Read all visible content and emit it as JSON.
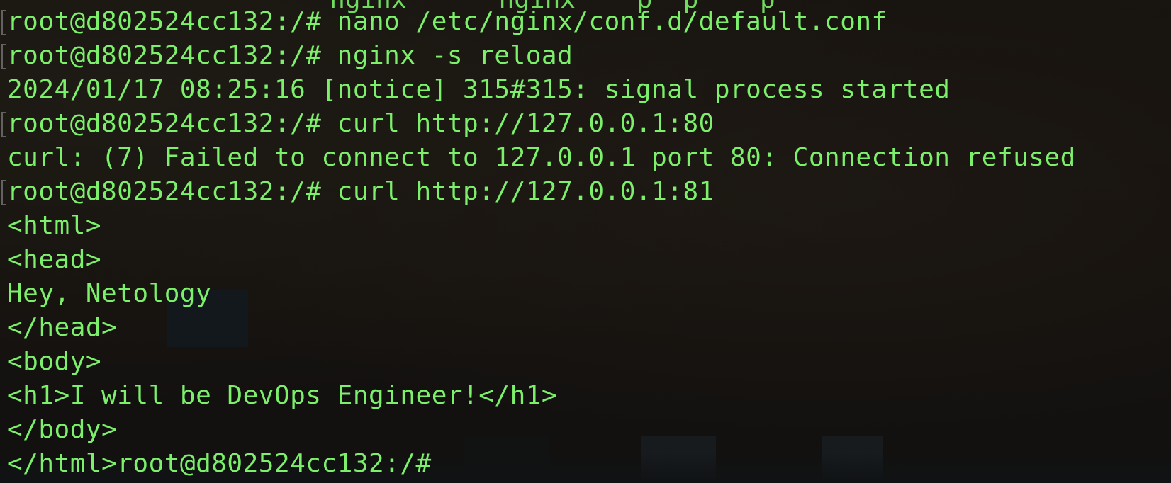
{
  "terminal": {
    "partial_line": "                     nginx      nginx    p  p    p   ",
    "lines": [
      "root@d802524cc132:/# nano /etc/nginx/conf.d/default.conf",
      "root@d802524cc132:/# nginx -s reload",
      "2024/01/17 08:25:16 [notice] 315#315: signal process started",
      "root@d802524cc132:/# curl http://127.0.0.1:80",
      "curl: (7) Failed to connect to 127.0.0.1 port 80: Connection refused",
      "root@d802524cc132:/# curl http://127.0.0.1:81",
      "<html>",
      "<head>",
      "Hey, Netology",
      "</head>",
      "<body>",
      "<h1>I will be DevOps Engineer!</h1>",
      "</body>",
      "</html>root@d802524cc132:/#"
    ],
    "text_color": "#7cf06b"
  }
}
